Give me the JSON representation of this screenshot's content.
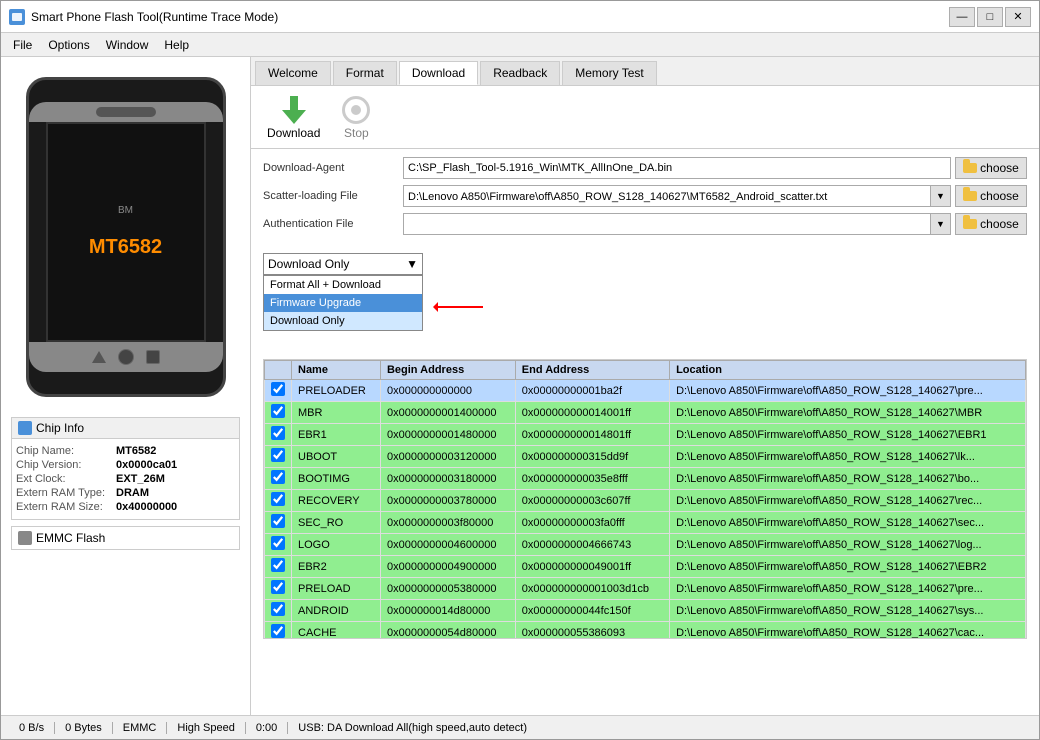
{
  "window": {
    "title": "Smart Phone Flash Tool(Runtime Trace Mode)",
    "icon": "smartphone-icon"
  },
  "titleButtons": {
    "minimize": "—",
    "maximize": "□",
    "close": "✕"
  },
  "menuBar": {
    "items": [
      "File",
      "Options",
      "Window",
      "Help"
    ]
  },
  "tabs": {
    "items": [
      "Welcome",
      "Format",
      "Download",
      "Readback",
      "Memory Test"
    ],
    "active": 2
  },
  "toolbar": {
    "download_label": "Download",
    "stop_label": "Stop"
  },
  "downloadAgent": {
    "label": "Download-Agent",
    "value": "C:\\SP_Flash_Tool-5.1916_Win\\MTK_AllInOne_DA.bin",
    "choose": "choose"
  },
  "scatterLoading": {
    "label": "Scatter-loading File",
    "value": "D:\\Lenovo A850\\Firmware\\off\\A850_ROW_S128_140627\\MT6582_Android_scatter.txt",
    "choose": "choose"
  },
  "authentication": {
    "label": "Authentication File",
    "value": "",
    "choose": "choose"
  },
  "modeDropdown": {
    "current": "Download Only",
    "options": [
      "Format All + Download",
      "Firmware Upgrade",
      "Download Only"
    ],
    "highlighted": 1,
    "selected": 2
  },
  "table": {
    "columns": [
      "",
      "Name",
      "Begin Address",
      "End Address",
      "Location"
    ],
    "rows": [
      {
        "checked": true,
        "name": "PRELOADER",
        "begin": "0x000000000000",
        "end": "0x00000000001ba2f",
        "location": "D:\\Lenovo A850\\Firmware\\off\\A850_ROW_S128_140627\\pre...",
        "highlight": true
      },
      {
        "checked": true,
        "name": "MBR",
        "begin": "0x0000000001400000",
        "end": "0x000000000014001ff",
        "location": "D:\\Lenovo A850\\Firmware\\off\\A850_ROW_S128_140627\\MBR"
      },
      {
        "checked": true,
        "name": "EBR1",
        "begin": "0x0000000001480000",
        "end": "0x000000000014801ff",
        "location": "D:\\Lenovo A850\\Firmware\\off\\A850_ROW_S128_140627\\EBR1"
      },
      {
        "checked": true,
        "name": "UBOOT",
        "begin": "0x0000000003120000",
        "end": "0x000000000315dd9f",
        "location": "D:\\Lenovo A850\\Firmware\\off\\A850_ROW_S128_140627\\lk..."
      },
      {
        "checked": true,
        "name": "BOOTIMG",
        "begin": "0x0000000003180000",
        "end": "0x000000000035e8fff",
        "location": "D:\\Lenovo A850\\Firmware\\off\\A850_ROW_S128_140627\\bo..."
      },
      {
        "checked": true,
        "name": "RECOVERY",
        "begin": "0x0000000003780000",
        "end": "0x00000000003c607ff",
        "location": "D:\\Lenovo A850\\Firmware\\off\\A850_ROW_S128_140627\\rec..."
      },
      {
        "checked": true,
        "name": "SEC_RO",
        "begin": "0x0000000003f80000",
        "end": "0x00000000003fa0fff",
        "location": "D:\\Lenovo A850\\Firmware\\off\\A850_ROW_S128_140627\\sec..."
      },
      {
        "checked": true,
        "name": "LOGO",
        "begin": "0x0000000004600000",
        "end": "0x0000000004666743",
        "location": "D:\\Lenovo A850\\Firmware\\off\\A850_ROW_S128_140627\\log..."
      },
      {
        "checked": true,
        "name": "EBR2",
        "begin": "0x0000000004900000",
        "end": "0x000000000049001ff",
        "location": "D:\\Lenovo A850\\Firmware\\off\\A850_ROW_S128_140627\\EBR2"
      },
      {
        "checked": true,
        "name": "PRELOAD",
        "begin": "0x0000000005380000",
        "end": "0x000000000001003d1cb",
        "location": "D:\\Lenovo A850\\Firmware\\off\\A850_ROW_S128_140627\\pre..."
      },
      {
        "checked": true,
        "name": "ANDROID",
        "begin": "0x000000014d80000",
        "end": "0x00000000044fc150f",
        "location": "D:\\Lenovo A850\\Firmware\\off\\A850_ROW_S128_140627\\sys..."
      },
      {
        "checked": true,
        "name": "CACHE",
        "begin": "0x0000000054d80000",
        "end": "0x000000055386093",
        "location": "D:\\Lenovo A850\\Firmware\\off\\A850_ROW_S128_140627\\cac..."
      }
    ]
  },
  "chipInfo": {
    "title": "Chip Info",
    "fields": [
      {
        "label": "Chip Name:",
        "value": "MT6582"
      },
      {
        "label": "Chip Version:",
        "value": "0x0000ca01"
      },
      {
        "label": "Ext Clock:",
        "value": "EXT_26M"
      },
      {
        "label": "Extern RAM Type:",
        "value": "DRAM"
      },
      {
        "label": "Extern RAM Size:",
        "value": "0x40000000"
      }
    ]
  },
  "emmc": {
    "label": "EMMC Flash"
  },
  "statusBar": {
    "speed": "0 B/s",
    "bytes": "0 Bytes",
    "type": "EMMC",
    "mode": "High Speed",
    "time": "0:00",
    "usb_info": "USB: DA Download All(high speed,auto detect)"
  },
  "phone": {
    "brand": "BM",
    "model": "MT6582"
  }
}
